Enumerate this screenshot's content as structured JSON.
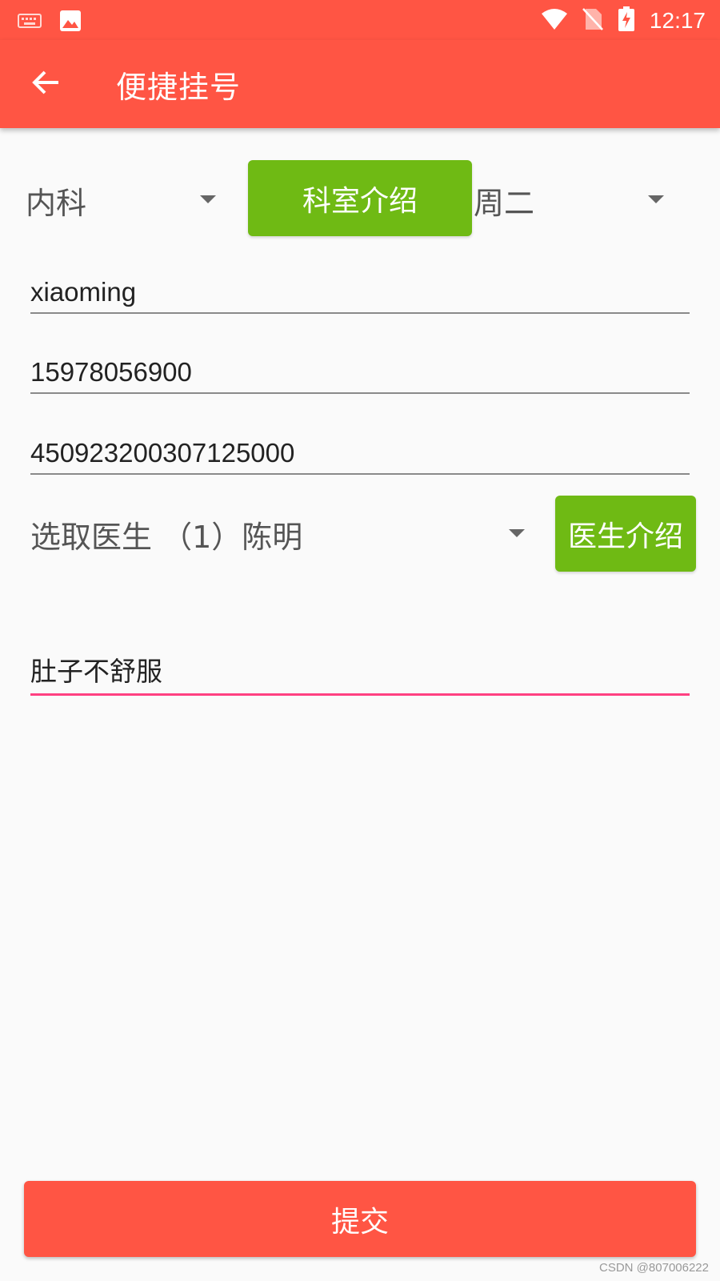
{
  "status_bar": {
    "time": "12:17",
    "icons_left": [
      "keyboard-icon",
      "image-icon"
    ],
    "icons_right": [
      "wifi-icon",
      "no-sim-icon",
      "battery-charging-icon"
    ]
  },
  "toolbar": {
    "title": "便捷挂号",
    "back_icon": "arrow-left-icon"
  },
  "department_spinner": {
    "value": "内科"
  },
  "department_intro_button": {
    "label": "科室介绍"
  },
  "day_spinner": {
    "value": "周二"
  },
  "form": {
    "name_value": "xiaoming",
    "phone_value": "15978056900",
    "id_value": "450923200307125000",
    "symptom_value": "肚子不舒服"
  },
  "doctor_spinner": {
    "value": "选取医生 （1）陈明"
  },
  "doctor_intro_button": {
    "label": "医生介绍"
  },
  "submit_button": {
    "label": "提交"
  },
  "watermark": "CSDN @807006222",
  "colors": {
    "primary": "#ff5544",
    "accent_green": "#6fba14",
    "focus_underline": "#ff4081"
  }
}
